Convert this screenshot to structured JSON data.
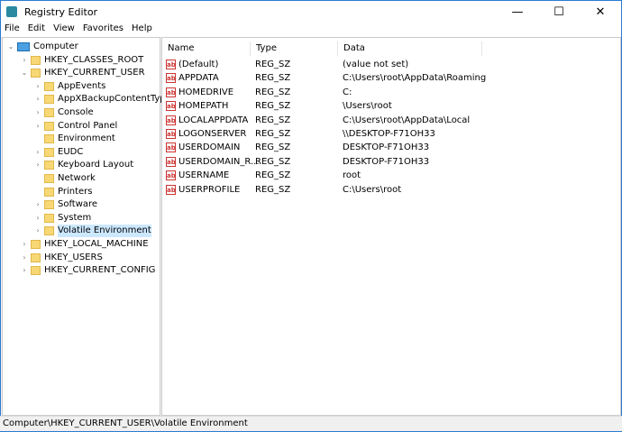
{
  "window": {
    "title": "Registry Editor",
    "minimize": "—",
    "maximize": "☐",
    "close": "✕"
  },
  "menu": [
    "File",
    "Edit",
    "View",
    "Favorites",
    "Help"
  ],
  "tree": [
    {
      "label": "Computer",
      "depth": 0,
      "arrow": "v",
      "icon": "computer"
    },
    {
      "label": "HKEY_CLASSES_ROOT",
      "depth": 1,
      "arrow": ">"
    },
    {
      "label": "HKEY_CURRENT_USER",
      "depth": 1,
      "arrow": "v"
    },
    {
      "label": "AppEvents",
      "depth": 2,
      "arrow": ">"
    },
    {
      "label": "AppXBackupContentTyp",
      "depth": 2,
      "arrow": ">"
    },
    {
      "label": "Console",
      "depth": 2,
      "arrow": ">"
    },
    {
      "label": "Control Panel",
      "depth": 2,
      "arrow": ">"
    },
    {
      "label": "Environment",
      "depth": 2,
      "arrow": ""
    },
    {
      "label": "EUDC",
      "depth": 2,
      "arrow": ">"
    },
    {
      "label": "Keyboard Layout",
      "depth": 2,
      "arrow": ">"
    },
    {
      "label": "Network",
      "depth": 2,
      "arrow": ""
    },
    {
      "label": "Printers",
      "depth": 2,
      "arrow": ""
    },
    {
      "label": "Software",
      "depth": 2,
      "arrow": ">"
    },
    {
      "label": "System",
      "depth": 2,
      "arrow": ">"
    },
    {
      "label": "Volatile Environment",
      "depth": 2,
      "arrow": ">",
      "selected": true
    },
    {
      "label": "HKEY_LOCAL_MACHINE",
      "depth": 1,
      "arrow": ">"
    },
    {
      "label": "HKEY_USERS",
      "depth": 1,
      "arrow": ">"
    },
    {
      "label": "HKEY_CURRENT_CONFIG",
      "depth": 1,
      "arrow": ">"
    }
  ],
  "columns": [
    "Name",
    "Type",
    "Data"
  ],
  "values": [
    [
      "(Default)",
      "REG_SZ",
      "(value not set)"
    ],
    [
      "APPDATA",
      "REG_SZ",
      "C:\\Users\\root\\AppData\\Roaming"
    ],
    [
      "HOMEDRIVE",
      "REG_SZ",
      "C:"
    ],
    [
      "HOMEPATH",
      "REG_SZ",
      "\\Users\\root"
    ],
    [
      "LOCALAPPDATA",
      "REG_SZ",
      "C:\\Users\\root\\AppData\\Local"
    ],
    [
      "LOGONSERVER",
      "REG_SZ",
      "\\\\DESKTOP-F71OH33"
    ],
    [
      "USERDOMAIN",
      "REG_SZ",
      "DESKTOP-F71OH33"
    ],
    [
      "USERDOMAIN_R...",
      "REG_SZ",
      "DESKTOP-F71OH33"
    ],
    [
      "USERNAME",
      "REG_SZ",
      "root"
    ],
    [
      "USERPROFILE",
      "REG_SZ",
      "C:\\Users\\root"
    ]
  ],
  "value_icon": "ab",
  "status": "Computer\\HKEY_CURRENT_USER\\Volatile Environment"
}
